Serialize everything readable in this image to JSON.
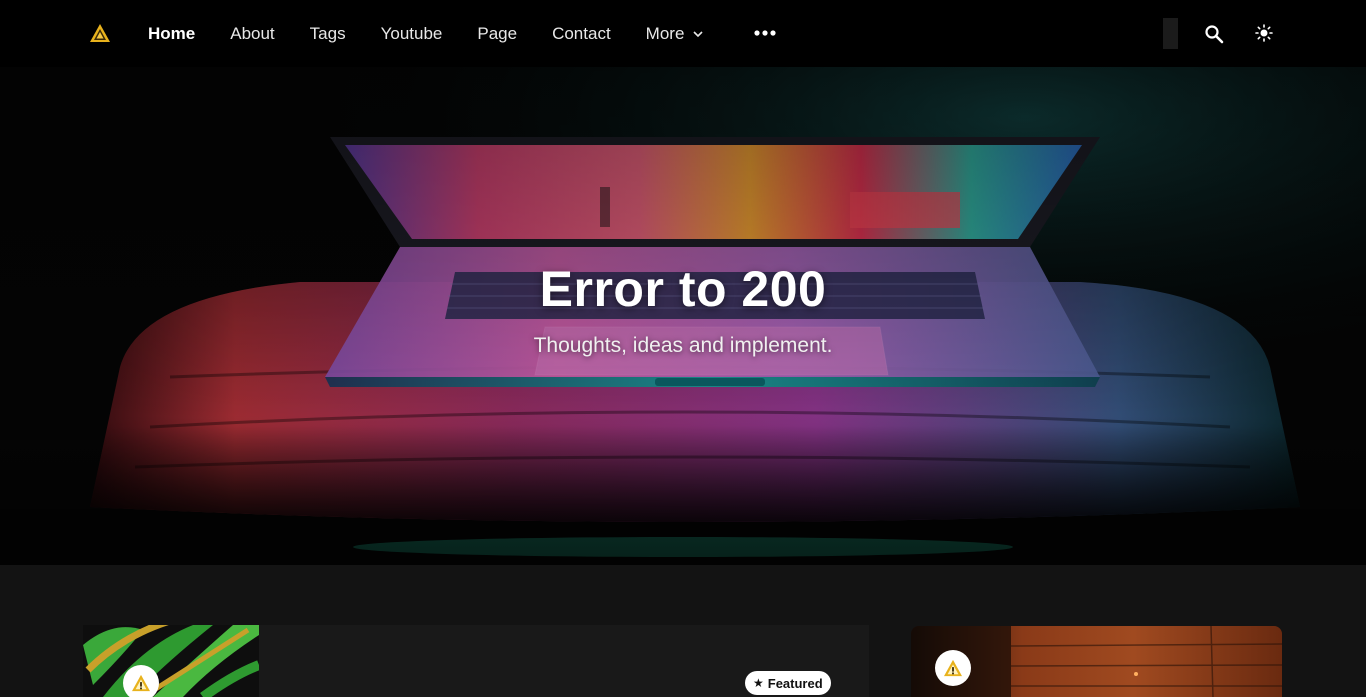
{
  "site": {
    "logo_icon": "triangle-logo-icon"
  },
  "nav": {
    "items": [
      {
        "label": "Home",
        "active": true
      },
      {
        "label": "About"
      },
      {
        "label": "Tags"
      },
      {
        "label": "Youtube"
      },
      {
        "label": "Page"
      },
      {
        "label": "Contact"
      },
      {
        "label": "More",
        "has_dropdown": true
      }
    ],
    "overflow_icon": "more-dots-icon",
    "search_icon": "search-icon",
    "theme_icon": "sun-icon"
  },
  "hero": {
    "title": "Error to 200",
    "subtitle": "Thoughts, ideas and implement."
  },
  "featured": {
    "badge_label": "Featured",
    "badge_icon": "star-icon"
  },
  "colors": {
    "accent_gold": "#e8b21c",
    "background": "#131313",
    "header": "#000000"
  }
}
